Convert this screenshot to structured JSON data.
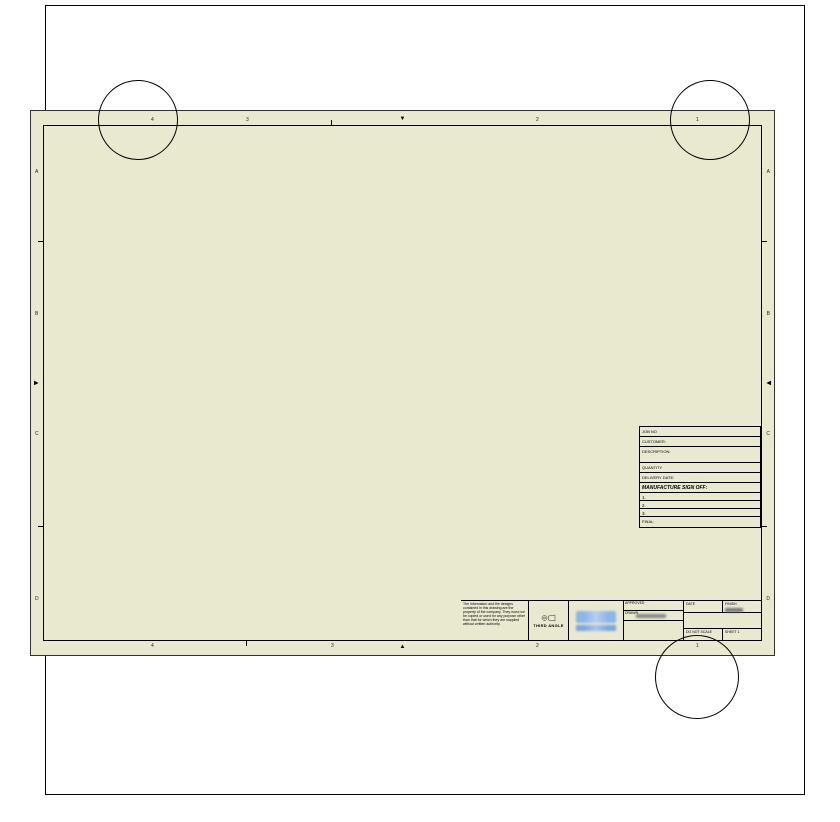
{
  "zones": {
    "columns": [
      "4",
      "3",
      "2",
      "1"
    ],
    "rows_left": [
      "A",
      "B",
      "C",
      "D"
    ],
    "rows_right": [
      "A",
      "B",
      "C",
      "D"
    ]
  },
  "center_marks": {
    "top": "▼",
    "bottom": "▲",
    "left": "▶",
    "right": "◀"
  },
  "upper_block": {
    "job_no_label": "JOB NO",
    "customer_label": "CUSTOMER:",
    "description_label": "DESCRIPTION:",
    "quantity_label": "QUANTITY",
    "delivery_label": "DELIVERY DATE:",
    "signoff_label": "MANUFACTURE SIGN OFF:",
    "row_a": "1.",
    "row_b": "2.",
    "row_c": "3.",
    "final_label": "FINAL:"
  },
  "lower_block": {
    "notes_text": "The information and the designs contained in this drawing are the property of the company. They must not be copied or used for any purpose other than that for which they are supplied without written authority.",
    "angle_label": "THIRD ANGLE",
    "approved_label": "APPROVED",
    "drawn_label": "DRAWN",
    "date_label": "DATE",
    "finish_label": "FINISH",
    "do_not_scale": "DO NOT SCALE",
    "sheet_label": "SHEET 1"
  }
}
